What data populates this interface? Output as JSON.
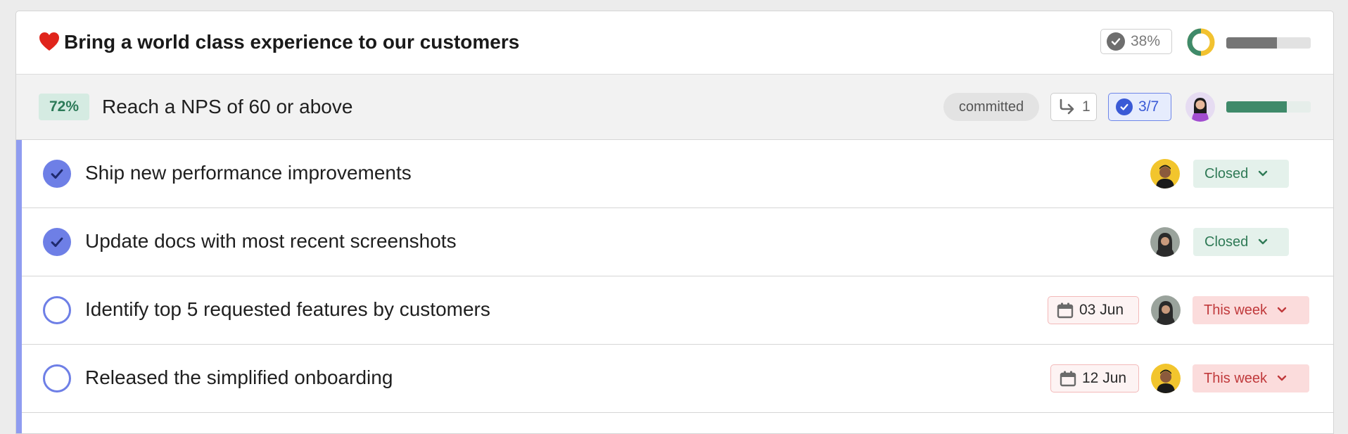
{
  "objective": {
    "icon": "heart-icon",
    "title": "Bring a world class experience to our customers",
    "progress_label": "38%",
    "progress": 0.38,
    "bar_fill": 0.6,
    "colors": {
      "donut_green": "#3f8a6a",
      "donut_yellow": "#f2c230"
    }
  },
  "key_result": {
    "percent_label": "72%",
    "title": "Reach a NPS of 60 or above",
    "status": "committed",
    "subitems_count": "1",
    "tasks_label": "3/7",
    "progress": 0.72
  },
  "tasks": [
    {
      "title": "Ship new performance improvements",
      "done": true,
      "state": "Closed",
      "state_kind": "closed",
      "date": ""
    },
    {
      "title": "Update docs with most recent screenshots",
      "done": true,
      "state": "Closed",
      "state_kind": "closed",
      "date": ""
    },
    {
      "title": "Identify top 5 requested features by customers",
      "done": false,
      "state": "This week",
      "state_kind": "week",
      "date": "03 Jun"
    },
    {
      "title": "Released the simplified onboarding",
      "done": false,
      "state": "This week",
      "state_kind": "week",
      "date": "12 Jun"
    }
  ]
}
